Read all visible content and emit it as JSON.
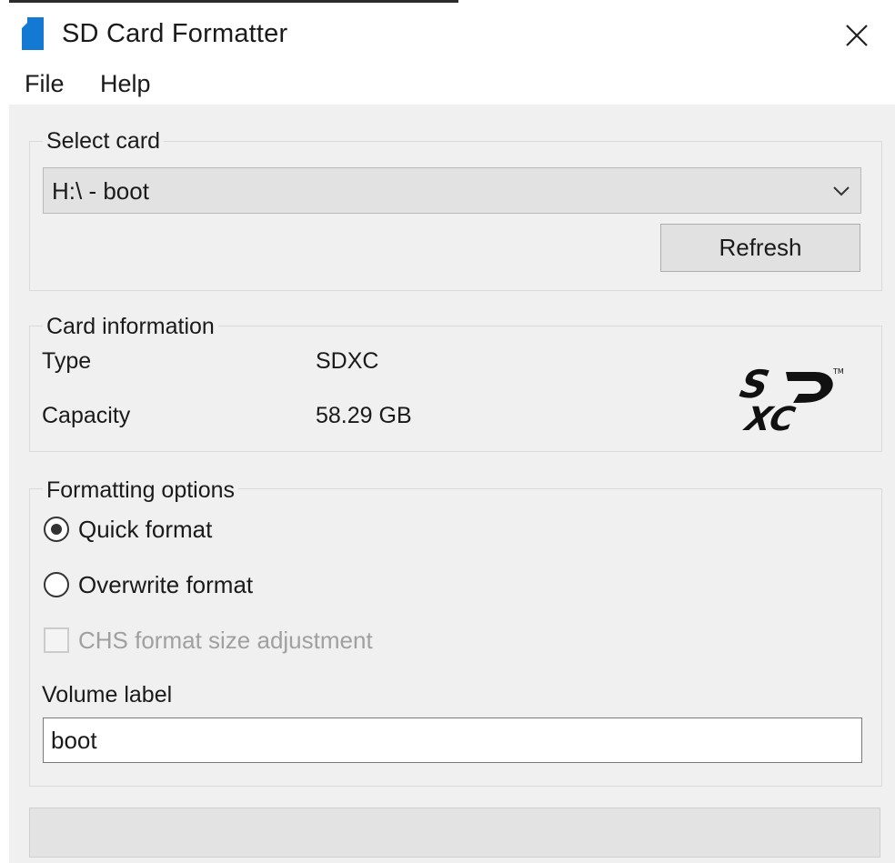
{
  "window": {
    "title": "SD Card Formatter",
    "icon": "sd-card-icon",
    "close_icon": "close-icon"
  },
  "menu": {
    "items": [
      {
        "label": "File"
      },
      {
        "label": "Help"
      }
    ]
  },
  "select_card": {
    "legend": "Select card",
    "selected": "H:\\ - boot",
    "refresh_label": "Refresh"
  },
  "card_info": {
    "legend": "Card information",
    "type_label": "Type",
    "type_value": "SDXC",
    "capacity_label": "Capacity",
    "capacity_value": "58.29 GB",
    "logo_icon": "sdxc-logo-icon"
  },
  "formatting": {
    "legend": "Formatting options",
    "quick_label": "Quick format",
    "quick_selected": true,
    "overwrite_label": "Overwrite format",
    "overwrite_selected": false,
    "chs_label": "CHS format size adjustment",
    "chs_checked": false,
    "chs_enabled": false,
    "volume_caption": "Volume label",
    "volume_value": "boot"
  },
  "colors": {
    "icon_blue": "#1479d2",
    "panel_bg": "#f0f0f0",
    "disabled_text": "#a0a0a0"
  }
}
